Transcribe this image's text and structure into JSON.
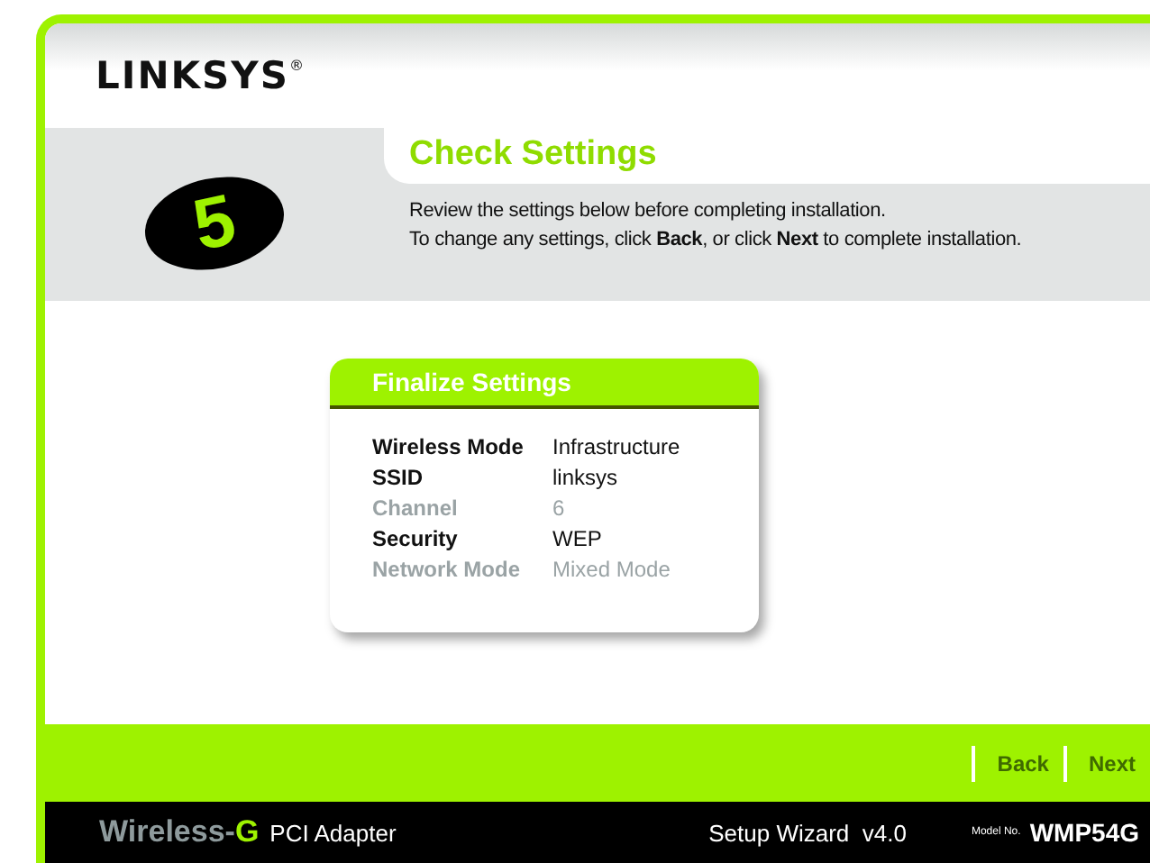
{
  "logo": {
    "text": "LINKSYS",
    "mark": "®"
  },
  "step": {
    "number": "5",
    "title": "Check Settings",
    "lines": [
      "Review the settings below before completing installation.",
      "To change any settings, click **Back**, or click **Next** to complete installation."
    ]
  },
  "panel": {
    "title": "Finalize Settings",
    "rows": [
      {
        "label": "Wireless Mode",
        "value": "Infrastructure",
        "disabled": false
      },
      {
        "label": "SSID",
        "value": "linksys",
        "disabled": false
      },
      {
        "label": "Channel",
        "value": "6",
        "disabled": true
      },
      {
        "label": "Security",
        "value": "WEP",
        "disabled": false
      },
      {
        "label": "Network Mode",
        "value": "Mixed Mode",
        "disabled": true
      }
    ]
  },
  "buttons": [
    "Back",
    "Next"
  ],
  "footer": {
    "brand": "Wireless-",
    "brand_suffix": "G",
    "product": "PCI Adapter",
    "wizard": "Setup Wizard  v4.0",
    "model_label": "Model No.",
    "model": "WMP54G"
  }
}
